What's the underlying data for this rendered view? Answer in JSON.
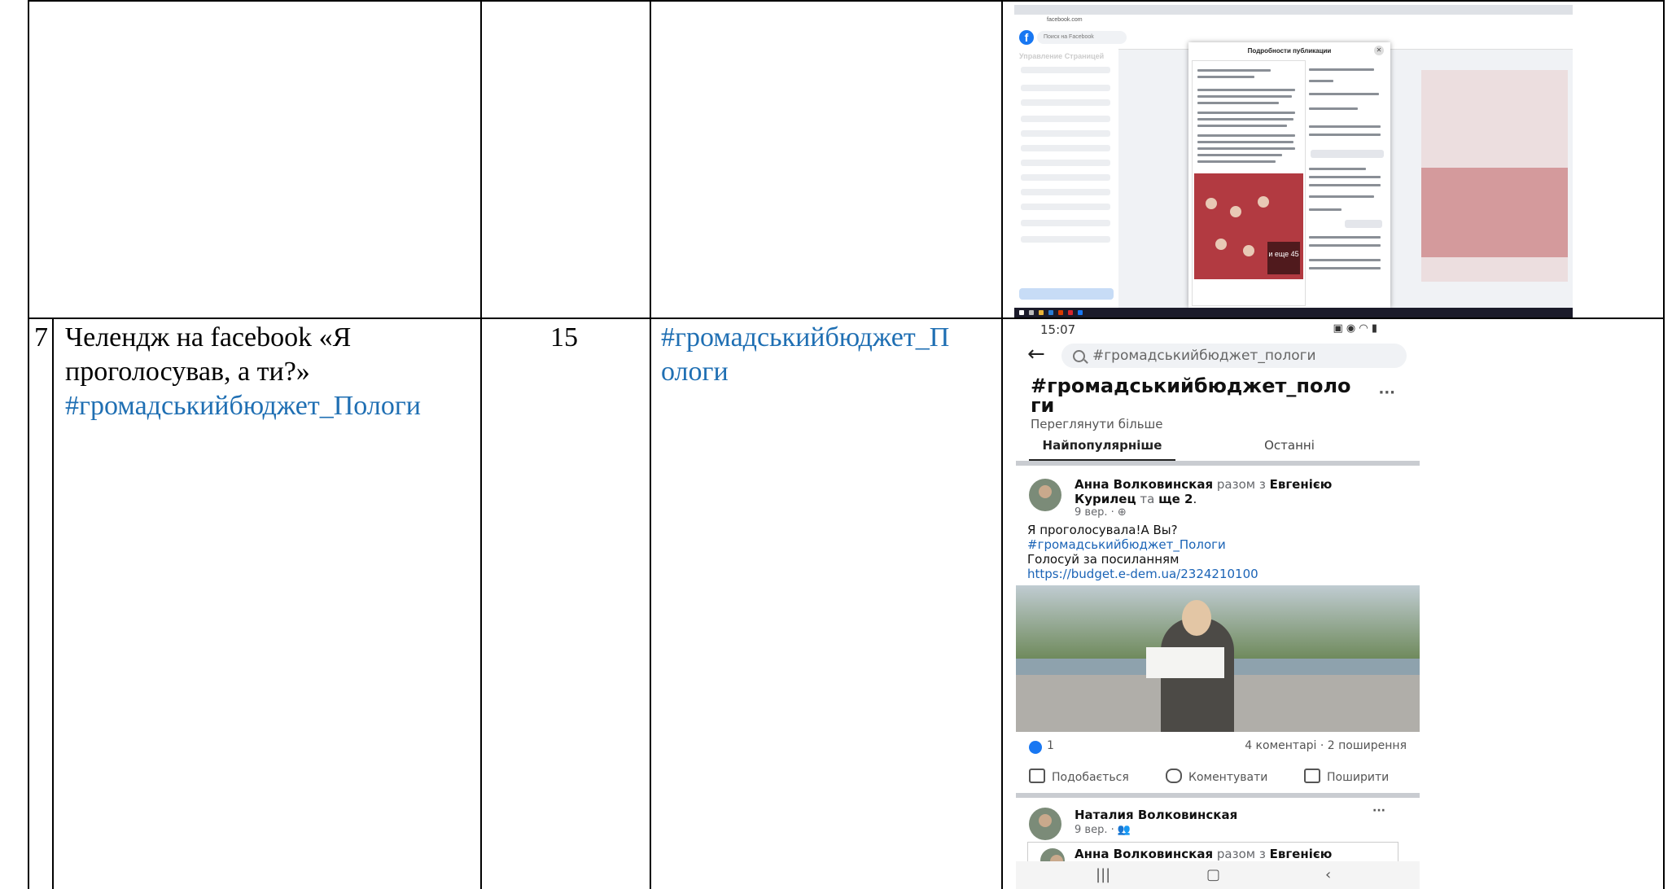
{
  "table": {
    "row7": {
      "number": "7",
      "description_line1": "Челендж на facebook «Я",
      "description_line2": "проголосував, а ти?»",
      "description_hashtag": "#громадськийбюджет_Пологи",
      "count": "15",
      "link_line1": "#громадськийбюджет_П",
      "link_line2": "ологи"
    }
  },
  "desktop_shot": {
    "search_placeholder": "Поиск на Facebook",
    "sidebar_title": "Управление Страницей",
    "modal_title": "Подробности публикации",
    "more_photos": "и еще 45"
  },
  "mobile_shot": {
    "status_time": "15:07",
    "search_query": "#громадськийбюджет_пологи",
    "heading_line1": "#громадськийбюджет_поло",
    "heading_line2": "ги",
    "see_more": "Переглянути більше",
    "tab_popular": "Найпопулярніше",
    "tab_recent": "Останні",
    "post1": {
      "author": "Анна Волковинская",
      "with_text": "разом з",
      "tagged": "Евгенією",
      "tagged2": "Курилец",
      "and_text": "та",
      "others": "ще 2",
      "date": "9 вер. · ",
      "line1": "Я проголосувала!А Вы?",
      "hashtag": "#громадськийбюджет_Пологи",
      "line3": "Голосуй за посиланням",
      "url": "https://budget.e-dem.ua/2324210100",
      "likes": "1",
      "stats": "4 коментарі · 2 поширення"
    },
    "actions": {
      "like": "Подобається",
      "comment": "Коментувати",
      "share": "Поширити"
    },
    "post2": {
      "author": "Наталия Волковинская",
      "date": "9 вер. · "
    },
    "post3": {
      "author": "Анна Волковинская",
      "with_text": "разом з",
      "tagged": "Евгенією"
    }
  }
}
